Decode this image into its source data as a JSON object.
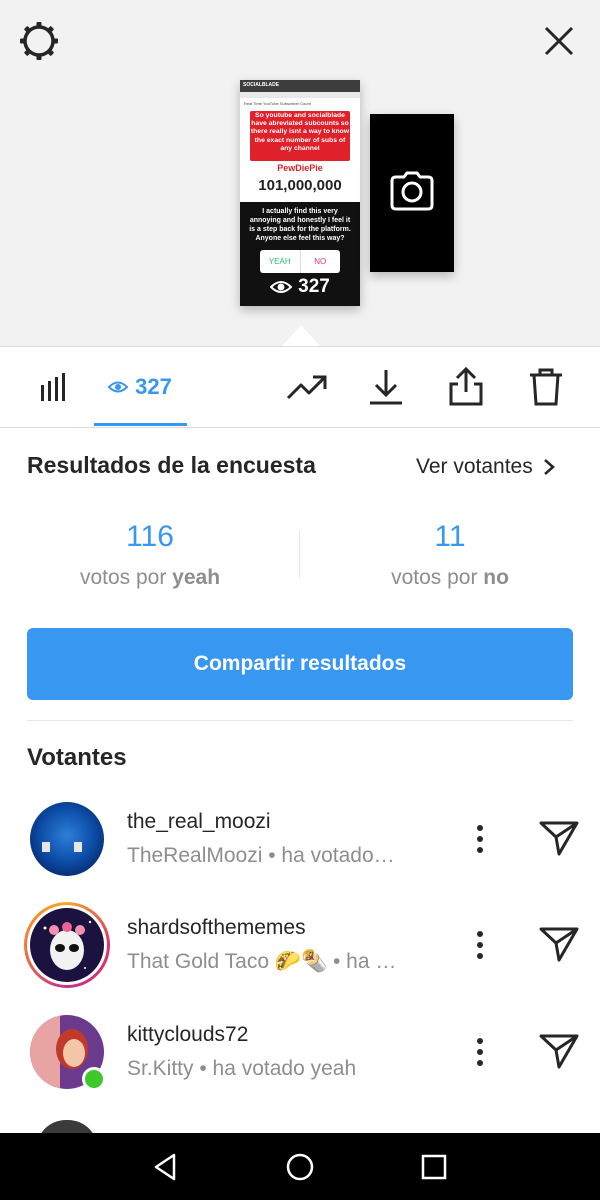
{
  "story": {
    "site_logo": "SOCIALBLADE",
    "page_title": "Real Time YouTube Subscriber Count",
    "red_text": "So youtube and socialblade have abreviated subcounts so there really isnt a way to know the exact number of subs of any channel",
    "channel": "PewDiePie",
    "count": "101,000,000",
    "question": "I actually find this very annoying and honestly I feel it is a step back for the platform. Anyone else feel this way?",
    "poll_yes": "YEAH",
    "poll_no": "NO",
    "views": "327"
  },
  "toolbar": {
    "views_count": "327",
    "accent": "#3897f0"
  },
  "results": {
    "title": "Resultados de la encuesta",
    "see_voters": "Ver votantes",
    "option_a_count": "116",
    "option_a_prefix": "votos por ",
    "option_a_name": "yeah",
    "option_b_count": "11",
    "option_b_prefix": "votos por ",
    "option_b_name": "no",
    "share_label": "Compartir resultados"
  },
  "voters": {
    "title": "Votantes",
    "items": [
      {
        "username": "the_real_moozi",
        "subtitle": "TheRealMoozi • ha votado…"
      },
      {
        "username": "shardsofthememes",
        "subtitle": "That Gold Taco 🌮🌯 • ha …"
      },
      {
        "username": "kittyclouds72",
        "subtitle": "Sr.Kitty • ha votado yeah"
      }
    ]
  }
}
